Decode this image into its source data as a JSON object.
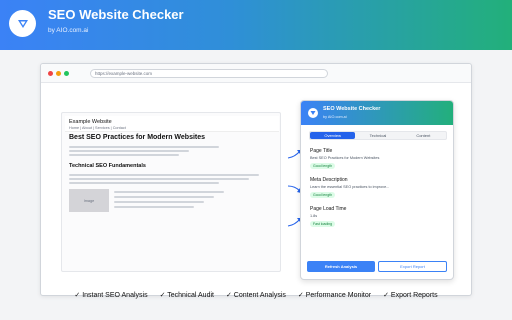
{
  "header": {
    "title": "SEO Website Checker",
    "subtitle": "by AIO.com.ai",
    "icon": "triangle-down-icon"
  },
  "browser": {
    "url": "https://example-website.com",
    "controls": [
      "#ef4444",
      "#f59e0b",
      "#22c55e"
    ]
  },
  "website": {
    "name": "Example Website",
    "nav": "Home | About | Services | Contact",
    "heading": "Best SEO Practices for Modern Websites",
    "subheading": "Technical SEO Fundamentals",
    "image_label": "Image"
  },
  "extension": {
    "title": "SEO Website Checker",
    "subtitle": "by AIO.com.ai",
    "tabs": [
      {
        "label": "Overview",
        "active": true
      },
      {
        "label": "Technical",
        "active": false
      },
      {
        "label": "Content",
        "active": false
      }
    ],
    "cards": [
      {
        "title": "Page Title",
        "text": "Best SEO Practices for Modern Websites",
        "badge": "Good length"
      },
      {
        "title": "Meta Description",
        "text": "Learn the essential SEO practices to improve...",
        "badge": "Good length"
      },
      {
        "title": "Page Load Time",
        "text": "1.8s",
        "badge": "Fast loading"
      }
    ],
    "primary_button": "Refresh Analysis",
    "secondary_button": "Export Report"
  },
  "features": [
    "✓ Instant SEO Analysis",
    "✓ Technical Audit",
    "✓ Content Analysis",
    "✓ Performance Monitor",
    "✓ Export Reports"
  ],
  "colors": {
    "brand_blue": "#3b82f6",
    "brand_green": "#22b07a",
    "badge_green": "#15803d"
  }
}
